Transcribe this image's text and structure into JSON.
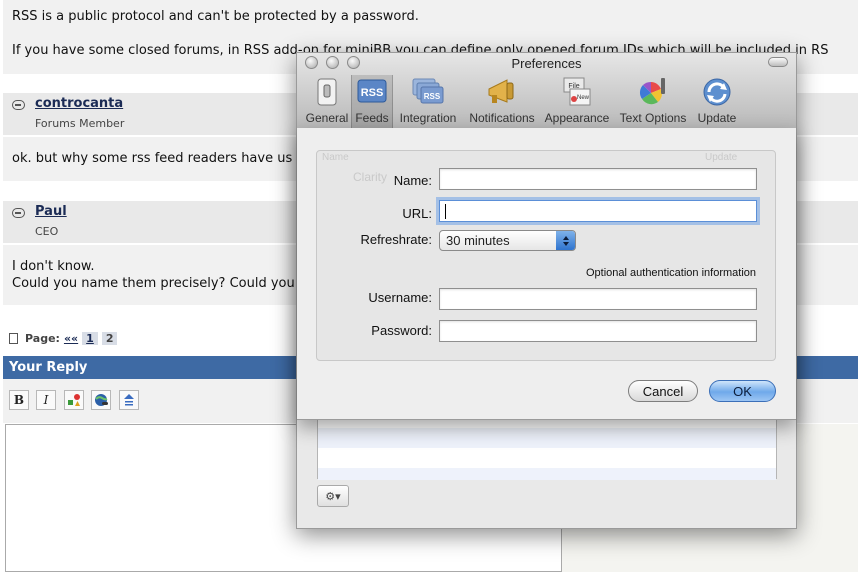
{
  "forum": {
    "intro_line1": "RSS is a public protocol and can't be protected by a password.",
    "intro_line2": "If you have some closed forums, in RSS add-on for miniBB you can define only opened forum IDs which will be included in RS",
    "posts": [
      {
        "author": "controcanta",
        "role": "Forums Member",
        "text": "ok. but why some rss feed readers have us"
      },
      {
        "author": "Paul",
        "role": "CEO",
        "text_line1": "I don't know.",
        "text_line2": "Could you name them precisely? Could you"
      }
    ],
    "pager": {
      "label": "Page:",
      "prev": "««",
      "pages": [
        "1",
        "2"
      ]
    },
    "reply_header": "Your Reply",
    "format_buttons": {
      "bold": "B",
      "italic": "I"
    }
  },
  "preferences": {
    "title": "Preferences",
    "toolbar": [
      {
        "label": "General",
        "icon": "switch-icon"
      },
      {
        "label": "Feeds",
        "icon": "rss-icon",
        "selected": true
      },
      {
        "label": "Integration",
        "icon": "rss-stack-icon"
      },
      {
        "label": "Notifications",
        "icon": "megaphone-icon"
      },
      {
        "label": "Appearance",
        "icon": "file-new-icon"
      },
      {
        "label": "Text Options",
        "icon": "color-wheel-icon"
      },
      {
        "label": "Update",
        "icon": "update-icon"
      }
    ],
    "list_ghost": {
      "col_name": "Name",
      "col_update": "Update",
      "row_name": "Clarity"
    }
  },
  "sheet": {
    "name_label": "Name:",
    "name_value": "",
    "url_label": "URL:",
    "url_value": "",
    "refresh_label": "Refreshrate:",
    "refresh_value": "30 minutes",
    "auth_note": "Optional authentication information",
    "username_label": "Username:",
    "username_value": "",
    "password_label": "Password:",
    "password_value": "",
    "cancel_label": "Cancel",
    "ok_label": "OK"
  },
  "colors": {
    "reply_header": "#3e6aa4",
    "focus_ring": "#6ea0e6",
    "ok_button": "#6fa9ea"
  }
}
